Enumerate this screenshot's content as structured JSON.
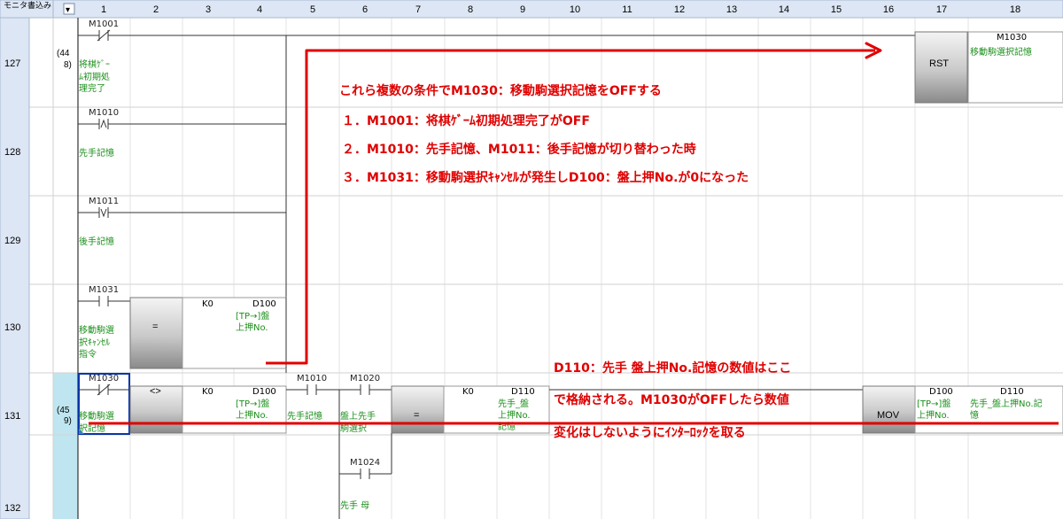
{
  "header": {
    "monitor_write_label": "モニタ書込み",
    "dropdown_glyph": "▾",
    "columns": [
      "1",
      "2",
      "3",
      "4",
      "5",
      "6",
      "7",
      "8",
      "9",
      "10",
      "11",
      "12",
      "13",
      "14",
      "15",
      "16",
      "17",
      "18"
    ]
  },
  "rows": [
    {
      "number": "127",
      "step_lines": [
        "(44",
        "8)"
      ]
    },
    {
      "number": "128",
      "step_lines": []
    },
    {
      "number": "129",
      "step_lines": []
    },
    {
      "number": "130",
      "step_lines": []
    },
    {
      "number": "131",
      "step_lines": [
        "(45",
        "9)"
      ]
    },
    {
      "number": "132",
      "step_lines": []
    }
  ],
  "contacts": [
    {
      "device": "M1001",
      "comment": [
        "将棋ｹﾞｰ",
        "ﾑ初期処",
        "理完了"
      ]
    },
    {
      "device": "M1010",
      "comment": [
        "先手記憶"
      ]
    },
    {
      "device": "M1011",
      "comment": [
        "後手記憶"
      ]
    },
    {
      "device": "M1031",
      "comment": [
        "移動駒選",
        "択ｷｬﾝｾﾙ",
        "指令"
      ]
    },
    {
      "device": "M1030",
      "comment": [
        "移動駒選",
        "択記憶"
      ]
    },
    {
      "device": "M1010",
      "comment": [
        "先手記憶"
      ]
    },
    {
      "device": "M1020",
      "comment": [
        "盤上先手",
        "駒選択"
      ]
    },
    {
      "device": "M1024",
      "comment": [
        "先手 母",
        "[TRIMMED]"
      ]
    }
  ],
  "instructions": {
    "rst": {
      "label": "RST",
      "device": "M1030",
      "comment": [
        "移動駒選択記憶"
      ]
    },
    "cmp_eq_130": {
      "op": "=",
      "s1": "K0",
      "s2": "D100",
      "s2_comment": [
        "[TP→]盤",
        "上押No."
      ]
    },
    "cmp_ne_131": {
      "op": "<>",
      "s1": "K0",
      "s2": "D100",
      "s2_comment": [
        "[TP→]盤",
        "上押No."
      ]
    },
    "cmp_eq_131": {
      "op": "=",
      "s1": "K0",
      "s2": "D110",
      "s2_comment": [
        "先手_盤",
        "上押No.",
        "記憶"
      ]
    },
    "mov": {
      "label": "MOV",
      "s": "D100",
      "s_comment": [
        "[TP→]盤",
        "上押No."
      ],
      "d": "D110",
      "d_comment": [
        "先手_盤上押No.記",
        "憶"
      ]
    }
  },
  "annotations": {
    "main_lines": [
      "これら複数の条件でM1030：移動駒選択記憶をOFFする",
      "１．M1001：将棋ｹﾞｰﾑ初期処理完了がOFF",
      "２．M1010：先手記憶、M1011：後手記憶が切り替わった時",
      "３．M1031：移動駒選択ｷｬﾝｾﾙが発生しD100：盤上押No.が0になった"
    ],
    "sub_lines": [
      "D110：先手 盤上押No.記憶の数値はここ",
      "で格納される。M1030がOFFしたら数値",
      "変化はしないようにｲﾝﾀｰﾛｯｸを取る"
    ]
  },
  "colors": {
    "annotation_red": "#e00000",
    "comment_green": "#1c8f1c",
    "header_bg": "#dce6f4",
    "selected_cell": "#0b35a8",
    "step_column_highlight": "#bfe6f0"
  }
}
